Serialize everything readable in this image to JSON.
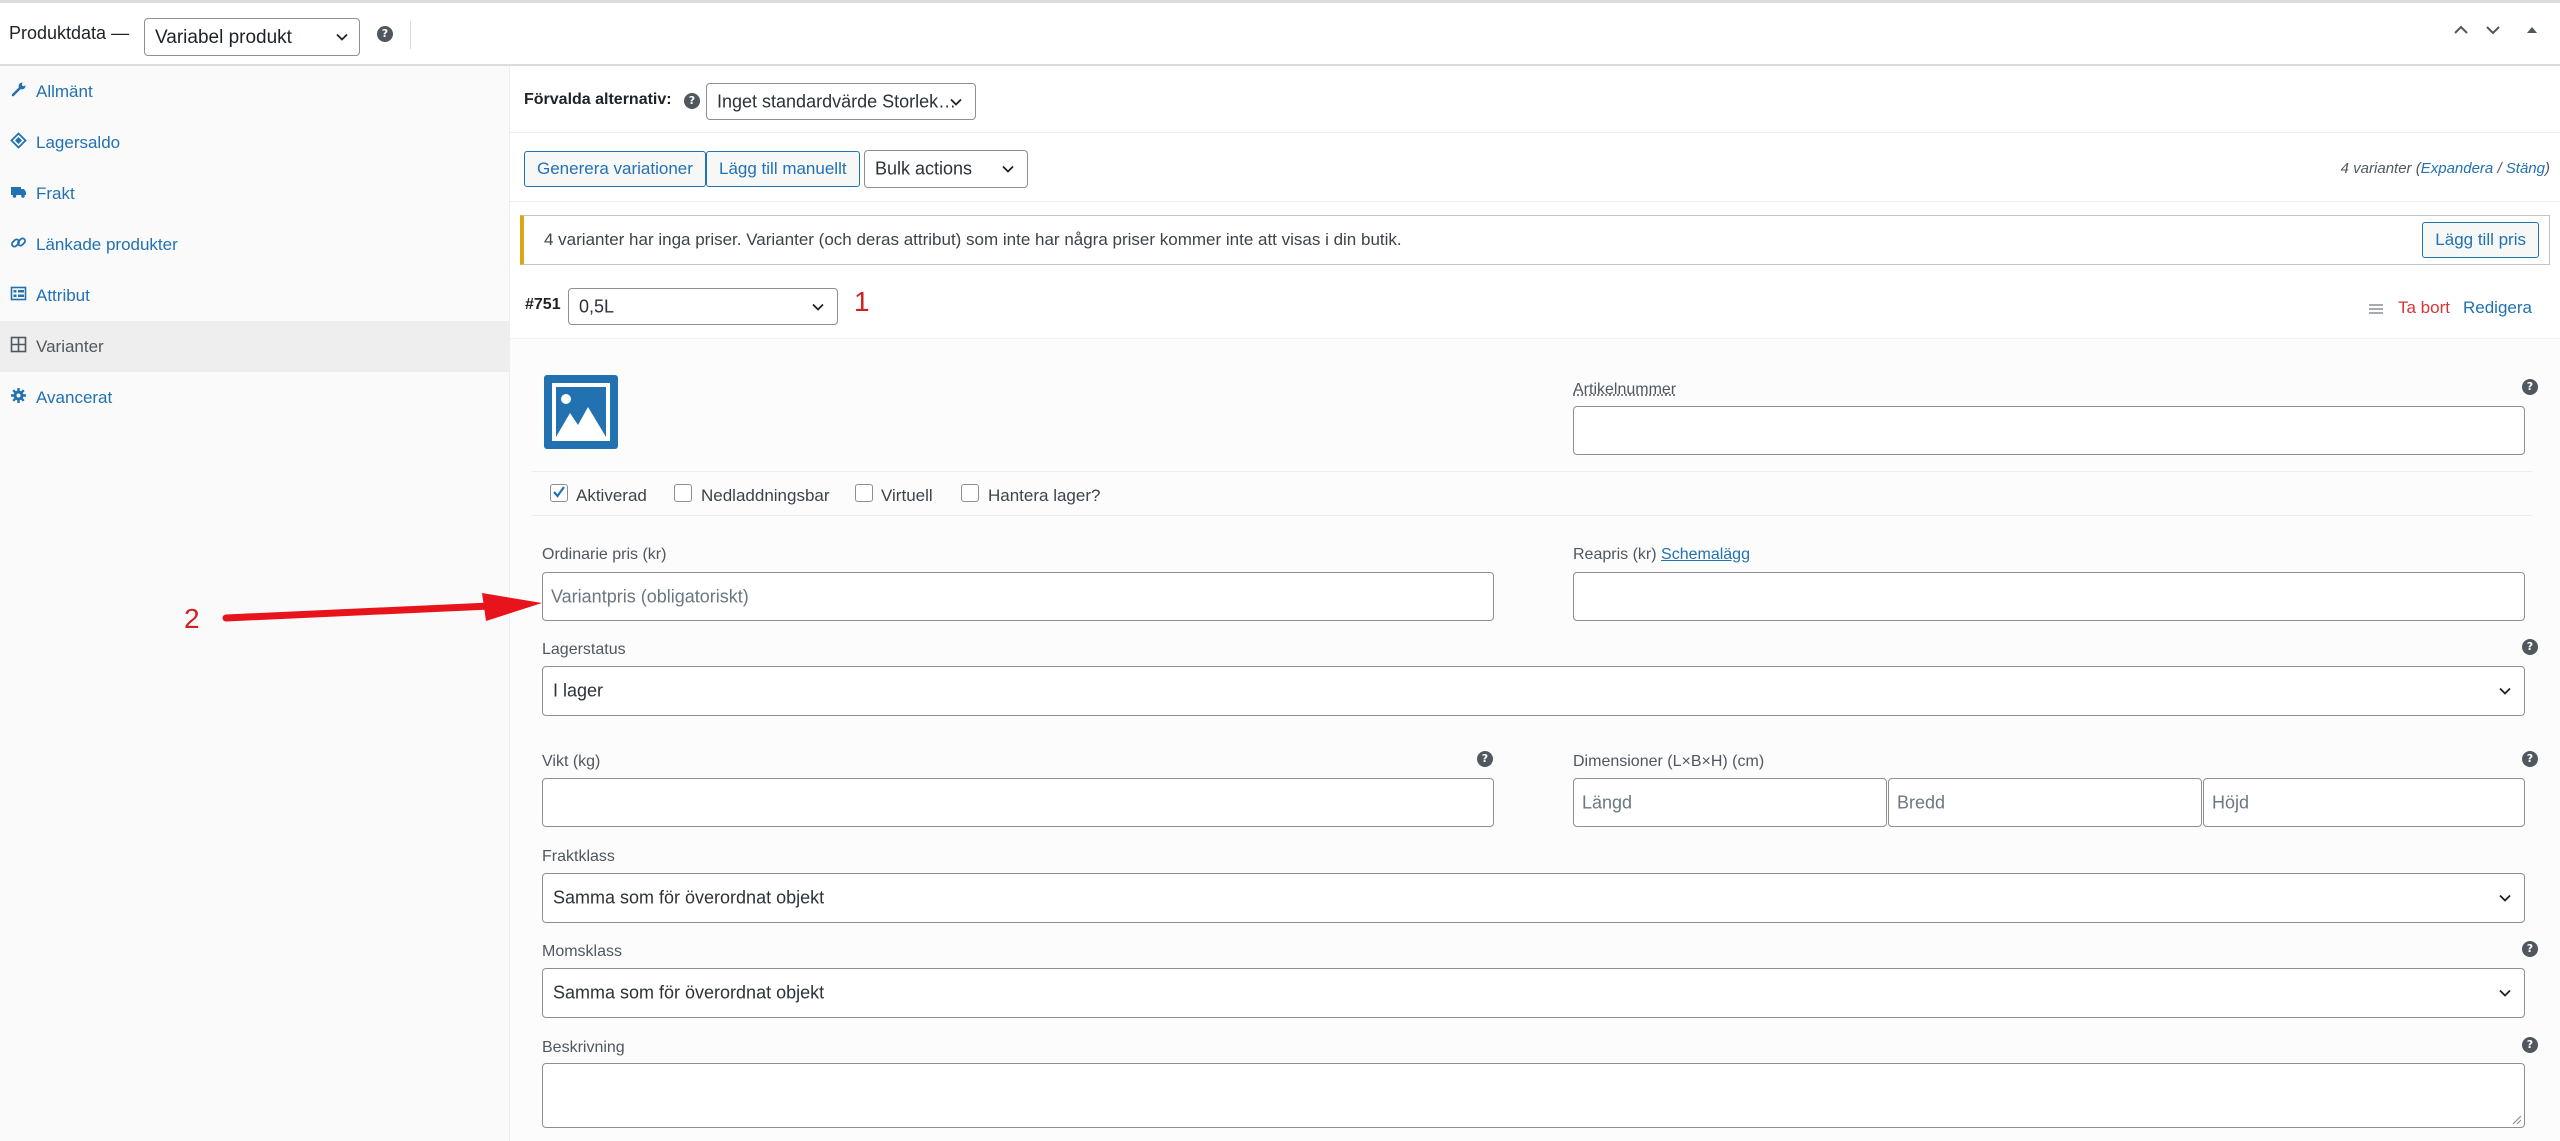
{
  "header": {
    "title": "Produktdata —",
    "product_type": "Variabel produkt"
  },
  "sidebar": {
    "items": [
      {
        "label": "Allmänt",
        "icon": "wrench-icon"
      },
      {
        "label": "Lagersaldo",
        "icon": "tag-icon"
      },
      {
        "label": "Frakt",
        "icon": "truck-icon"
      },
      {
        "label": "Länkade produkter",
        "icon": "link-icon"
      },
      {
        "label": "Attribut",
        "icon": "list-icon"
      },
      {
        "label": "Varianter",
        "icon": "grid-icon"
      },
      {
        "label": "Avancerat",
        "icon": "gear-icon"
      }
    ],
    "active": "Varianter"
  },
  "defaults": {
    "label": "Förvalda alternativ:",
    "value": "Inget standardvärde Storlek…"
  },
  "toolbar": {
    "generate_label": "Generera variationer",
    "add_manual_label": "Lägg till manuellt",
    "bulk_actions": "Bulk actions",
    "count_text": "4 varianter",
    "expand_label": "Expandera",
    "separator": "/",
    "close_label": "Stäng"
  },
  "notice": {
    "text": "4 varianter har inga priser. Varianter (och deras attribut) som inte har några priser kommer inte att visas i din butik.",
    "button_label": "Lägg till pris",
    "accent_color": "#dba617"
  },
  "variation": {
    "id": "#751",
    "attribute_value": "0,5L",
    "remove_label": "Ta bort",
    "edit_label": "Redigera",
    "sku_label": "Artikelnummer",
    "sku_value": "",
    "checkboxes": [
      {
        "label": "Aktiverad",
        "checked": true
      },
      {
        "label": "Nedladdningsbar",
        "checked": false
      },
      {
        "label": "Virtuell",
        "checked": false
      },
      {
        "label": "Hantera lager?",
        "checked": false
      }
    ],
    "regular_price_label": "Ordinarie pris (kr)",
    "regular_price_placeholder": "Variantpris (obligatoriskt)",
    "sale_price_label": "Reapris (kr)",
    "schedule_label": "Schemalägg",
    "stock_status_label": "Lagerstatus",
    "stock_status_value": "I lager",
    "weight_label": "Vikt (kg)",
    "dimensions_label": "Dimensioner (L×B×H) (cm)",
    "length_placeholder": "Längd",
    "width_placeholder": "Bredd",
    "height_placeholder": "Höjd",
    "shipping_class_label": "Fraktklass",
    "shipping_class_value": "Samma som för överordnat objekt",
    "tax_class_label": "Momsklass",
    "tax_class_value": "Samma som för överordnat objekt",
    "description_label": "Beskrivning"
  },
  "annotations": {
    "marker_1": "1",
    "marker_2": "2",
    "color": "#d21f1f"
  },
  "colors": {
    "link": "#2271b1",
    "danger": "#d63638",
    "border": "#8c8f94"
  }
}
